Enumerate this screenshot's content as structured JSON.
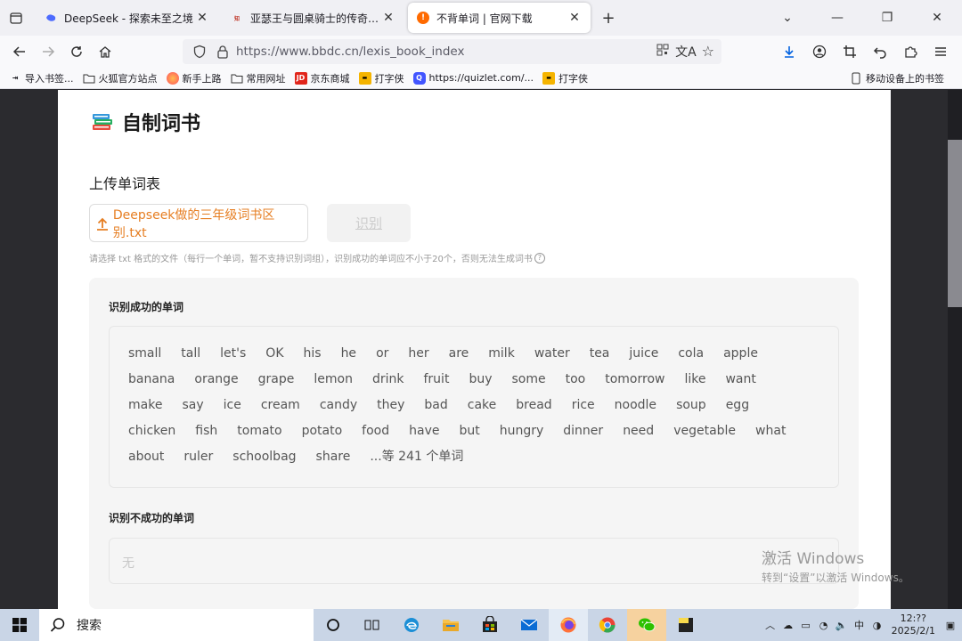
{
  "browser": {
    "tabs": [
      {
        "title": "DeepSeek - 探索未至之境",
        "active": false
      },
      {
        "title": "亚瑟王与圆桌骑士的传奇故事 |",
        "active": false
      },
      {
        "title": "不背单词 | 官网下载",
        "active": true
      }
    ],
    "url": "https://www.bbdc.cn/lexis_book_index",
    "bookmarks": [
      {
        "label": "导入书签...",
        "icon": "import-icon"
      },
      {
        "label": "火狐官方站点",
        "icon": "folder-icon"
      },
      {
        "label": "新手上路",
        "icon": "firefox-icon"
      },
      {
        "label": "常用网址",
        "icon": "folder-icon"
      },
      {
        "label": "京东商城",
        "icon": "jd-icon"
      },
      {
        "label": "打字侠",
        "icon": "typing-icon"
      },
      {
        "label": "https://quizlet.com/...",
        "icon": "quizlet-icon"
      },
      {
        "label": "打字侠",
        "icon": "typing-icon"
      }
    ],
    "mobile_bookmarks": "移动设备上的书签"
  },
  "page": {
    "title": "自制词书",
    "upload_label": "上传单词表",
    "file_name": "Deepseek做的三年级词书区别.txt",
    "recognize_button": "识别",
    "hint": "请选择 txt 格式的文件（每行一个单词，暂不支持识别词组），识别成功的单词应不小于20个，否则无法生成词书",
    "success_heading": "识别成功的单词",
    "words": [
      "small",
      "tall",
      "let's",
      "OK",
      "his",
      "he",
      "or",
      "her",
      "are",
      "milk",
      "water",
      "tea",
      "juice",
      "cola",
      "apple",
      "banana",
      "orange",
      "grape",
      "lemon",
      "drink",
      "fruit",
      "buy",
      "some",
      "too",
      "tomorrow",
      "like",
      "want",
      "make",
      "say",
      "ice",
      "cream",
      "candy",
      "they",
      "bad",
      "cake",
      "bread",
      "rice",
      "noodle",
      "soup",
      "egg",
      "chicken",
      "fish",
      "tomato",
      "potato",
      "food",
      "have",
      "but",
      "hungry",
      "dinner",
      "need",
      "vegetable",
      "what",
      "about",
      "ruler",
      "schoolbag",
      "share"
    ],
    "more_text": "...等 241 个单词",
    "fail_heading": "识别不成功的单词",
    "fail_value": "无"
  },
  "watermark": {
    "line1": "激活 Windows",
    "line2": "转到“设置”以激活 Windows。"
  },
  "taskbar": {
    "search_placeholder": "搜索",
    "ime": "中",
    "time": "12:??",
    "date": "2025/2/1"
  },
  "colors": {
    "accent_orange": "#e67e22",
    "tab_bg": "#f0f0f4",
    "page_bg": "#ffffff",
    "taskbar_bg": "#c9d5e6"
  }
}
